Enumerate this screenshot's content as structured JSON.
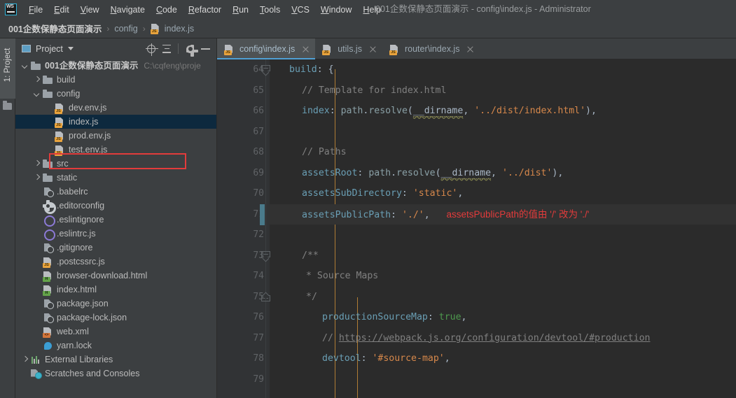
{
  "window": {
    "title": "001企数保静态页面演示 - config\\index.js - Administrator",
    "logo_text": "WS"
  },
  "menu": {
    "items": [
      {
        "label": "File",
        "mnemonic": "F"
      },
      {
        "label": "Edit",
        "mnemonic": "E"
      },
      {
        "label": "View",
        "mnemonic": "V"
      },
      {
        "label": "Navigate",
        "mnemonic": "N"
      },
      {
        "label": "Code",
        "mnemonic": "C"
      },
      {
        "label": "Refactor",
        "mnemonic": "R"
      },
      {
        "label": "Run",
        "mnemonic": "R"
      },
      {
        "label": "Tools",
        "mnemonic": "T"
      },
      {
        "label": "VCS",
        "mnemonic": "V"
      },
      {
        "label": "Window",
        "mnemonic": "W"
      },
      {
        "label": "Help",
        "mnemonic": "H"
      }
    ]
  },
  "breadcrumb": {
    "items": [
      "001企数保静态页面演示",
      "config",
      "index.js"
    ],
    "separator": "›"
  },
  "toolstrip": {
    "project_tab": "1: Project"
  },
  "project_panel": {
    "title": "Project",
    "toolbar": {
      "locate": "locate-in-tree",
      "collapse": "collapse-all",
      "settings": "settings",
      "hide": "hide"
    },
    "tree": [
      {
        "label": "001企数保静态页面演示",
        "hint": "C:\\cqfeng\\proje",
        "icon": "folder",
        "indent": 0,
        "arrow": "open",
        "bold": true
      },
      {
        "label": "build",
        "icon": "folder",
        "indent": 1,
        "arrow": "closed"
      },
      {
        "label": "config",
        "icon": "folder",
        "indent": 1,
        "arrow": "open"
      },
      {
        "label": "dev.env.js",
        "icon": "js",
        "indent": 2,
        "arrow": "none"
      },
      {
        "label": "index.js",
        "icon": "js",
        "indent": 2,
        "arrow": "none",
        "selected": true,
        "highlighted": true
      },
      {
        "label": "prod.env.js",
        "icon": "js",
        "indent": 2,
        "arrow": "none"
      },
      {
        "label": "test.env.js",
        "icon": "js",
        "indent": 2,
        "arrow": "none"
      },
      {
        "label": "src",
        "icon": "folder",
        "indent": 1,
        "arrow": "closed"
      },
      {
        "label": "static",
        "icon": "folder",
        "indent": 1,
        "arrow": "closed"
      },
      {
        "label": ".babelrc",
        "icon": "json",
        "indent": 1,
        "arrow": "none"
      },
      {
        "label": ".editorconfig",
        "icon": "config",
        "indent": 1,
        "arrow": "none"
      },
      {
        "label": ".eslintignore",
        "icon": "eslint",
        "indent": 1,
        "arrow": "none"
      },
      {
        "label": ".eslintrc.js",
        "icon": "eslint",
        "indent": 1,
        "arrow": "none"
      },
      {
        "label": ".gitignore",
        "icon": "git",
        "indent": 1,
        "arrow": "none"
      },
      {
        "label": ".postcssrc.js",
        "icon": "js",
        "indent": 1,
        "arrow": "none"
      },
      {
        "label": "browser-download.html",
        "icon": "html",
        "indent": 1,
        "arrow": "none"
      },
      {
        "label": "index.html",
        "icon": "html",
        "indent": 1,
        "arrow": "none"
      },
      {
        "label": "package.json",
        "icon": "json",
        "indent": 1,
        "arrow": "none"
      },
      {
        "label": "package-lock.json",
        "icon": "json",
        "indent": 1,
        "arrow": "none"
      },
      {
        "label": "web.xml",
        "icon": "xml",
        "indent": 1,
        "arrow": "none"
      },
      {
        "label": "yarn.lock",
        "icon": "yarn",
        "indent": 1,
        "arrow": "none"
      },
      {
        "label": "External Libraries",
        "icon": "libs",
        "indent": 0,
        "arrow": "closed"
      },
      {
        "label": "Scratches and Consoles",
        "icon": "scratches",
        "indent": 0,
        "arrow": "none"
      }
    ]
  },
  "editor": {
    "tabs": [
      {
        "label": "config\\index.js",
        "icon": "js",
        "active": true
      },
      {
        "label": "utils.js",
        "icon": "js",
        "active": false
      },
      {
        "label": "router\\index.js",
        "icon": "js",
        "active": false
      }
    ],
    "first_line_number": 64,
    "line_numbers": [
      64,
      65,
      66,
      67,
      68,
      69,
      70,
      71,
      72,
      73,
      74,
      75,
      76,
      77,
      78,
      79
    ],
    "current_line": 71,
    "annotation": "assetsPublicPath的值由 '/' 改为 './'",
    "annotation_color": "#e43b3b",
    "lines": {
      "l64": "build: {",
      "l65": "// Template for index.html",
      "l66": "index: path.resolve(__dirname, '../dist/index.html'),",
      "l67": "",
      "l68": "// Paths",
      "l69": "assetsRoot: path.resolve(__dirname, '../dist'),",
      "l70": "assetsSubDirectory: 'static',",
      "l71": "assetsPublicPath: './',",
      "l72": "",
      "l73": "/**",
      "l74": " * Source Maps",
      "l75": " */",
      "l76": "productionSourceMap: true,",
      "l77": "// https://webpack.js.org/configuration/devtool/#production",
      "l78": "devtool: '#source-map',",
      "l79": ""
    },
    "tokens": {
      "build": "build",
      "colon": ":",
      "brace_open": "{",
      "comment_template": "// Template for index.html",
      "index": "index",
      "path": "path",
      "dot": ".",
      "resolve": "resolve",
      "paren_open": "(",
      "dirname": "__dirname",
      "comma": ",",
      "str_index_html": "'../dist/index.html'",
      "paren_close_comma": "),",
      "comment_paths": "// Paths",
      "assetsRoot": "assetsRoot",
      "str_dist": "'../dist'",
      "assetsSubDirectory": "assetsSubDirectory",
      "str_static": "'static'",
      "assetsPublicPath": "assetsPublicPath",
      "str_dotslash": "'./'",
      "block_open": "/**",
      "block_mid": "* Source Maps",
      "block_close": "*/",
      "productionSourceMap": "productionSourceMap",
      "bool_true": "true",
      "comment_url": "// ",
      "url": "https://webpack.js.org/configuration/devtool/#production",
      "devtool": "devtool",
      "str_sourcemap": "'#source-map'",
      "trailing_comma": ","
    }
  },
  "colors": {
    "accent": "#4f9fd4",
    "annotation": "#e43b3b",
    "selection": "#0d293e",
    "editor_bg": "#2b2b2b",
    "panel_bg": "#3c3f41",
    "gutter_bg": "#313335",
    "changebar": "#4a7b8c",
    "indent_guide": "#b07d35"
  }
}
